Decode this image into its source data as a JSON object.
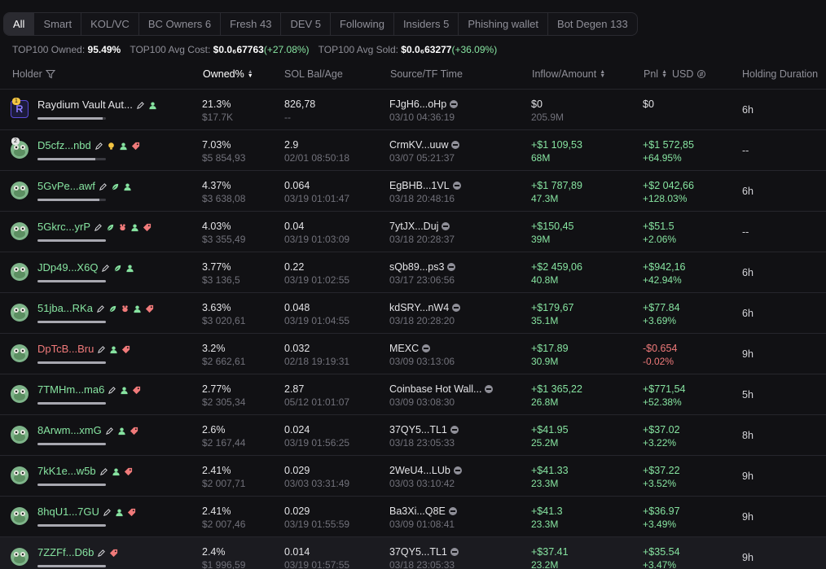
{
  "tabs": [
    {
      "label": "All",
      "active": true
    },
    {
      "label": "Smart"
    },
    {
      "label": "KOL/VC"
    },
    {
      "label": "BC Owners 6"
    },
    {
      "label": "Fresh 43"
    },
    {
      "label": "DEV 5"
    },
    {
      "label": "Following"
    },
    {
      "label": "Insiders 5"
    },
    {
      "label": "Phishing wallet"
    },
    {
      "label": "Bot Degen 133"
    }
  ],
  "stats": {
    "owned_label": "TOP100 Owned:",
    "owned_value": "95.49%",
    "avg_cost_label": "TOP100 Avg Cost:",
    "avg_cost_value": "$0.0₆67763",
    "avg_cost_change": "(+27.08%)",
    "avg_sold_label": "TOP100 Avg Sold:",
    "avg_sold_value": "$0.0₆63277",
    "avg_sold_change": "(+36.09%)"
  },
  "columns": {
    "holder": "Holder",
    "owned": "Owned%",
    "sol": "SOL Bal/Age",
    "source": "Source/TF Time",
    "inflow": "Inflow/Amount",
    "pnl": "Pnl",
    "currency": "USD",
    "duration": "Holding Duration"
  },
  "rows": [
    {
      "rank": "1",
      "rank_style": "gold",
      "avatar": "raydium",
      "name": "Raydium Vault Aut...",
      "name_color": "white",
      "tags": [
        "edit",
        "user"
      ],
      "bar": 0.95,
      "owned": "21.3%",
      "owned_usd": "$17.7K",
      "sol": "826,78",
      "age": "--",
      "source": "FJgH6...oHp",
      "source_time": "03/10 04:36:19",
      "inflow": "$0",
      "inflow_color": "white",
      "amount": "205.9M",
      "amount_color": "muted",
      "pnl": "$0",
      "pnl_color": "white",
      "pnl_pct": "",
      "pnl_pct_color": "muted",
      "duration": "6h"
    },
    {
      "rank": "2",
      "rank_style": "",
      "avatar": "frog",
      "name": "D5cfz...nbd",
      "name_color": "green",
      "tags": [
        "edit",
        "bulb",
        "user",
        "tag"
      ],
      "bar": 0.85,
      "owned": "7.03%",
      "owned_usd": "$5 854,93",
      "sol": "2.9",
      "age": "02/01 08:50:18",
      "source": "CrmKV...uuw",
      "source_time": "03/07 05:21:37",
      "inflow": "+$1 109,53",
      "inflow_color": "green",
      "amount": "68M",
      "amount_color": "green",
      "pnl": "+$1 572,85",
      "pnl_color": "green",
      "pnl_pct": "+64.95%",
      "pnl_pct_color": "green",
      "duration": "--"
    },
    {
      "rank": "",
      "rank_style": "",
      "avatar": "frog",
      "name": "5GvPe...awf",
      "name_color": "green",
      "tags": [
        "edit",
        "leaf",
        "user"
      ],
      "bar": 0.9,
      "owned": "4.37%",
      "owned_usd": "$3 638,08",
      "sol": "0.064",
      "age": "03/19 01:01:47",
      "source": "EgBHB...1VL",
      "source_time": "03/18 20:48:16",
      "inflow": "+$1 787,89",
      "inflow_color": "green",
      "amount": "47.3M",
      "amount_color": "green",
      "pnl": "+$2 042,66",
      "pnl_color": "green",
      "pnl_pct": "+128.03%",
      "pnl_pct_color": "green",
      "duration": "6h"
    },
    {
      "rank": "",
      "rank_style": "",
      "avatar": "frog",
      "name": "5Gkrc...yrP",
      "name_color": "green",
      "tags": [
        "edit",
        "leaf",
        "rat",
        "user",
        "tag"
      ],
      "bar": 1.0,
      "owned": "4.03%",
      "owned_usd": "$3 355,49",
      "sol": "0.04",
      "age": "03/19 01:03:09",
      "source": "7ytJX...Duj",
      "source_time": "03/18 20:28:37",
      "inflow": "+$150,45",
      "inflow_color": "green",
      "amount": "39M",
      "amount_color": "green",
      "pnl": "+$51.5",
      "pnl_color": "green",
      "pnl_pct": "+2.06%",
      "pnl_pct_color": "green",
      "duration": "--"
    },
    {
      "rank": "",
      "rank_style": "",
      "avatar": "frog",
      "name": "JDp49...X6Q",
      "name_color": "green",
      "tags": [
        "edit",
        "leaf",
        "user"
      ],
      "bar": 1.0,
      "owned": "3.77%",
      "owned_usd": "$3 136,5",
      "sol": "0.22",
      "age": "03/19 01:02:55",
      "source": "sQb89...ps3",
      "source_time": "03/17 23:06:56",
      "inflow": "+$2 459,06",
      "inflow_color": "green",
      "amount": "40.8M",
      "amount_color": "green",
      "pnl": "+$942,16",
      "pnl_color": "green",
      "pnl_pct": "+42.94%",
      "pnl_pct_color": "green",
      "duration": "6h"
    },
    {
      "rank": "",
      "rank_style": "",
      "avatar": "frog",
      "name": "51jba...RKa",
      "name_color": "green",
      "tags": [
        "edit",
        "leaf",
        "rat",
        "user",
        "tag"
      ],
      "bar": 1.0,
      "owned": "3.63%",
      "owned_usd": "$3 020,61",
      "sol": "0.048",
      "age": "03/19 01:04:55",
      "source": "kdSRY...nW4",
      "source_time": "03/18 20:28:20",
      "inflow": "+$179,67",
      "inflow_color": "green",
      "amount": "35.1M",
      "amount_color": "green",
      "pnl": "+$77.84",
      "pnl_color": "green",
      "pnl_pct": "+3.69%",
      "pnl_pct_color": "green",
      "duration": "6h"
    },
    {
      "rank": "",
      "rank_style": "",
      "avatar": "frog",
      "name": "DpTcB...Bru",
      "name_color": "red",
      "tags": [
        "edit",
        "user",
        "tag"
      ],
      "bar": 1.0,
      "owned": "3.2%",
      "owned_usd": "$2 662,61",
      "sol": "0.032",
      "age": "02/18 19:19:31",
      "source": "MEXC",
      "source_time": "03/09 03:13:06",
      "inflow": "+$17.89",
      "inflow_color": "green",
      "amount": "30.9M",
      "amount_color": "green",
      "pnl": "-$0.654",
      "pnl_color": "red",
      "pnl_pct": "-0.02%",
      "pnl_pct_color": "red",
      "duration": "9h"
    },
    {
      "rank": "",
      "rank_style": "",
      "avatar": "frog",
      "name": "7TMHm...ma6",
      "name_color": "green",
      "tags": [
        "edit",
        "user",
        "tag"
      ],
      "bar": 1.0,
      "owned": "2.77%",
      "owned_usd": "$2 305,34",
      "sol": "2.87",
      "age": "05/12 01:01:07",
      "source": "Coinbase Hot Wall...",
      "source_time": "03/09 03:08:30",
      "inflow": "+$1 365,22",
      "inflow_color": "green",
      "amount": "26.8M",
      "amount_color": "green",
      "pnl": "+$771,54",
      "pnl_color": "green",
      "pnl_pct": "+52.38%",
      "pnl_pct_color": "green",
      "duration": "5h"
    },
    {
      "rank": "",
      "rank_style": "",
      "avatar": "frog",
      "name": "8Arwm...xmG",
      "name_color": "green",
      "tags": [
        "edit",
        "user",
        "tag"
      ],
      "bar": 1.0,
      "owned": "2.6%",
      "owned_usd": "$2 167,44",
      "sol": "0.024",
      "age": "03/19 01:56:25",
      "source": "37QY5...TL1",
      "source_time": "03/18 23:05:33",
      "inflow": "+$41.95",
      "inflow_color": "green",
      "amount": "25.2M",
      "amount_color": "green",
      "pnl": "+$37.02",
      "pnl_color": "green",
      "pnl_pct": "+3.22%",
      "pnl_pct_color": "green",
      "duration": "8h"
    },
    {
      "rank": "",
      "rank_style": "",
      "avatar": "frog",
      "name": "7kK1e...w5b",
      "name_color": "green",
      "tags": [
        "edit",
        "user",
        "tag"
      ],
      "bar": 1.0,
      "owned": "2.41%",
      "owned_usd": "$2 007,71",
      "sol": "0.029",
      "age": "03/03 03:31:49",
      "source": "2WeU4...LUb",
      "source_time": "03/03 03:10:42",
      "inflow": "+$41.33",
      "inflow_color": "green",
      "amount": "23.3M",
      "amount_color": "green",
      "pnl": "+$37.22",
      "pnl_color": "green",
      "pnl_pct": "+3.52%",
      "pnl_pct_color": "green",
      "duration": "9h"
    },
    {
      "rank": "",
      "rank_style": "",
      "avatar": "frog",
      "name": "8hqU1...7GU",
      "name_color": "green",
      "tags": [
        "edit",
        "user",
        "tag"
      ],
      "bar": 1.0,
      "owned": "2.41%",
      "owned_usd": "$2 007,46",
      "sol": "0.029",
      "age": "03/19 01:55:59",
      "source": "Ba3Xi...Q8E",
      "source_time": "03/09 01:08:41",
      "inflow": "+$41.3",
      "inflow_color": "green",
      "amount": "23.3M",
      "amount_color": "green",
      "pnl": "+$36.97",
      "pnl_color": "green",
      "pnl_pct": "+3.49%",
      "pnl_pct_color": "green",
      "duration": "9h"
    },
    {
      "rank": "",
      "rank_style": "",
      "avatar": "frog",
      "name": "7ZZFf...D6b",
      "name_color": "green",
      "tags": [
        "edit",
        "tag"
      ],
      "bar": 1.0,
      "owned": "2.4%",
      "owned_usd": "$1 996,59",
      "sol": "0.014",
      "age": "03/19 01:57:55",
      "source": "37QY5...TL1",
      "source_time": "03/18 23:05:33",
      "inflow": "+$37.41",
      "inflow_color": "green",
      "amount": "23.2M",
      "amount_color": "green",
      "pnl": "+$35.54",
      "pnl_color": "green",
      "pnl_pct": "+3.47%",
      "pnl_pct_color": "green",
      "duration": "9h",
      "highlight": true
    }
  ],
  "colors": {
    "green": "#86e3a0",
    "red": "#f07a7a",
    "muted": "#71717a",
    "white": "#e4e4e7"
  }
}
